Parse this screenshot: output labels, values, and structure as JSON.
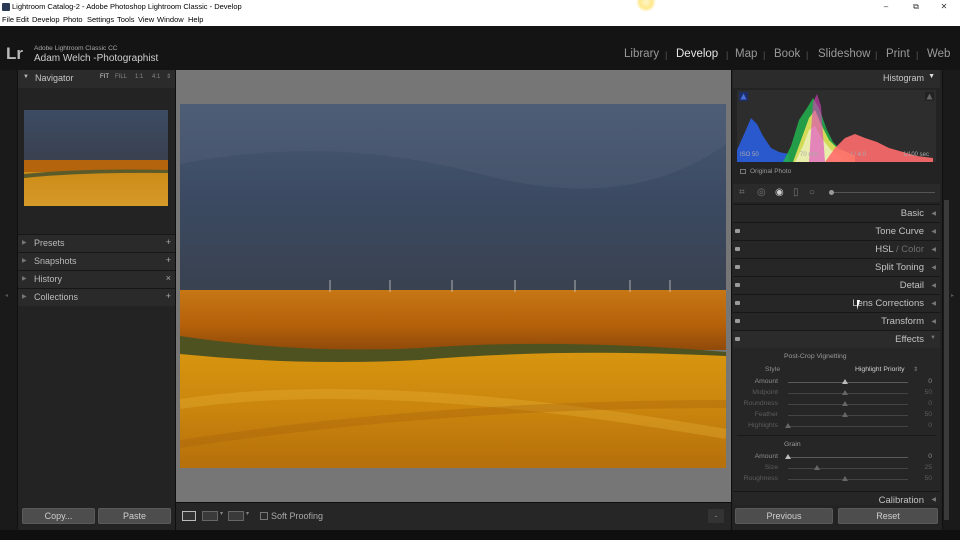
{
  "window": {
    "title": "Lightroom Catalog-2 - Adobe Photoshop Lightroom Classic - Develop",
    "minimize": "–",
    "maximize": "⧉",
    "close": "✕"
  },
  "menu": [
    "File",
    "Edit",
    "Develop",
    "Photo",
    "Settings",
    "Tools",
    "View",
    "Window",
    "Help"
  ],
  "identity": {
    "logo": "Lr",
    "product": "Adobe Lightroom Classic CC",
    "user": "Adam Welch -Photographist"
  },
  "modules": [
    "Library",
    "Develop",
    "Map",
    "Book",
    "Slideshow",
    "Print",
    "Web"
  ],
  "active_module": "Develop",
  "left": {
    "navigator": {
      "title": "Navigator",
      "zoom": [
        "FIT",
        "FILL",
        "1:1",
        "4:1"
      ]
    },
    "sections": [
      {
        "label": "Presets",
        "action": "+"
      },
      {
        "label": "Snapshots",
        "action": "+"
      },
      {
        "label": "History",
        "action": "×"
      },
      {
        "label": "Collections",
        "action": "+"
      }
    ],
    "copy": "Copy...",
    "paste": "Paste"
  },
  "toolbar": {
    "soft_proofing": "Soft Proofing"
  },
  "right": {
    "histogram": {
      "title": "Histogram",
      "iso": "ISO 50",
      "focal": "70 mm",
      "aperture": "f / 4.0",
      "shutter": "1/100 sec",
      "original_photo": "Original Photo"
    },
    "sections": [
      {
        "label": "Basic"
      },
      {
        "label": "Tone Curve"
      },
      {
        "label": "HSL",
        "sep": " / ",
        "alt": "Color"
      },
      {
        "label": "Split Toning"
      },
      {
        "label": "Detail"
      },
      {
        "label": "Lens Corrections"
      },
      {
        "label": "Transform"
      },
      {
        "label": "Effects"
      }
    ],
    "effects": {
      "vignette_title": "Post-Crop Vignetting",
      "style_label": "Style",
      "style_value": "Highlight Priority",
      "vignette_sliders": [
        {
          "label": "Amount",
          "value": "0",
          "pos": 0.5
        },
        {
          "label": "Midpoint",
          "value": "50",
          "pos": 0.5
        },
        {
          "label": "Roundness",
          "value": "0",
          "pos": 0.5
        },
        {
          "label": "Feather",
          "value": "50",
          "pos": 0.5
        },
        {
          "label": "Highlights",
          "value": "0",
          "pos": 0.0
        }
      ],
      "grain_title": "Grain",
      "grain_sliders": [
        {
          "label": "Amount",
          "value": "0",
          "pos": 0.0
        },
        {
          "label": "Size",
          "value": "25",
          "pos": 0.25
        },
        {
          "label": "Roughness",
          "value": "50",
          "pos": 0.5
        }
      ]
    },
    "calibration": "Calibration",
    "previous": "Previous",
    "reset": "Reset"
  },
  "colors": {
    "accent_text": "#e6e6e6",
    "panel_bg": "#232323",
    "center_bg": "#767676"
  }
}
